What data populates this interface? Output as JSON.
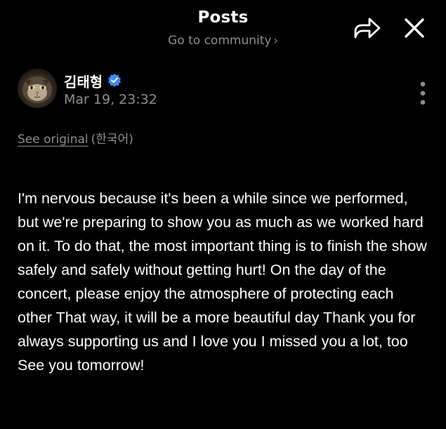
{
  "header": {
    "title": "Posts",
    "community_link": "Go to community",
    "community_chevron": "›"
  },
  "icons": {
    "share": "share-icon",
    "close": "close-icon",
    "more": "more-vertical-icon",
    "verified": "verified-badge-icon"
  },
  "author": {
    "name": "김태형",
    "timestamp": "Mar 19, 23:32"
  },
  "translation": {
    "see_original": "See original",
    "language": "(한국어)"
  },
  "post": {
    "body": "I'm nervous because it's been a while since we performed, but we're preparing to show you as much as we worked hard on it. To do that, the most important thing is to finish the show safely and safely without getting hurt! On the day of the concert, please enjoy the atmosphere of protecting each other That way, it will be a more beautiful day Thank you for always supporting us and I love you I missed you a lot, too See you tomorrow!"
  },
  "colors": {
    "background": "#000000",
    "text": "#ffffff",
    "secondary_text": "#8e8e93",
    "verified_badge": "#3b8cf6"
  }
}
